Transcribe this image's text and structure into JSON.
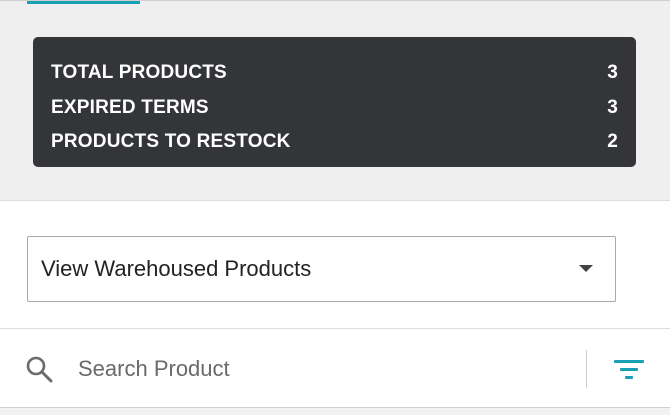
{
  "summary": {
    "rows": [
      {
        "label": "TOTAL PRODUCTS",
        "value": "3"
      },
      {
        "label": "EXPIRED TERMS",
        "value": "3"
      },
      {
        "label": "PRODUCTS TO RESTOCK",
        "value": "2"
      }
    ]
  },
  "view_select": {
    "selected": "View Warehoused Products"
  },
  "search": {
    "placeholder": "Search Product"
  },
  "icons": {
    "search": "search-icon",
    "dropdown": "chevron-down-icon",
    "filter": "filter-icon"
  },
  "colors": {
    "accent": "#1aa0b4",
    "card_bg": "#333538",
    "summary_bg": "#efefef"
  }
}
